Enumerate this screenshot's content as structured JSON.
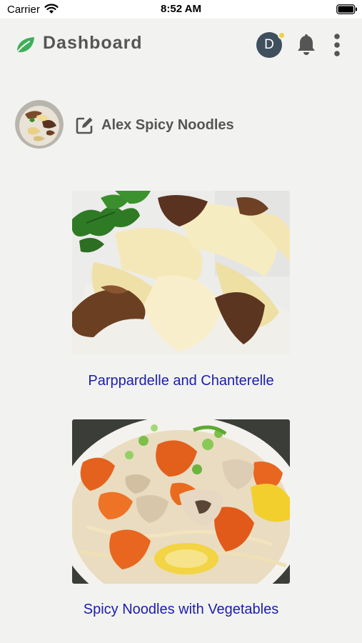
{
  "status_bar": {
    "carrier": "Carrier",
    "time": "8:52 AM"
  },
  "header": {
    "title": "Dashboard",
    "avatar_initial": "D"
  },
  "profile": {
    "name": "Alex Spicy Noodles"
  },
  "recipes": [
    {
      "title": "Parppardelle and Chanterelle"
    },
    {
      "title": "Spicy Noodles with Vegetables"
    }
  ],
  "icons": {
    "leaf": "leaf-icon",
    "bell": "bell-icon",
    "more": "more-vertical-icon",
    "edit": "edit-icon",
    "wifi": "wifi-icon",
    "battery": "battery-icon"
  },
  "colors": {
    "background": "#f2f3f1",
    "brand_green": "#3fae5a",
    "title_gray": "#555555",
    "link_blue": "#1c1cae",
    "avatar_bg": "#3e4f5e",
    "notify_dot": "#f4d03f"
  }
}
